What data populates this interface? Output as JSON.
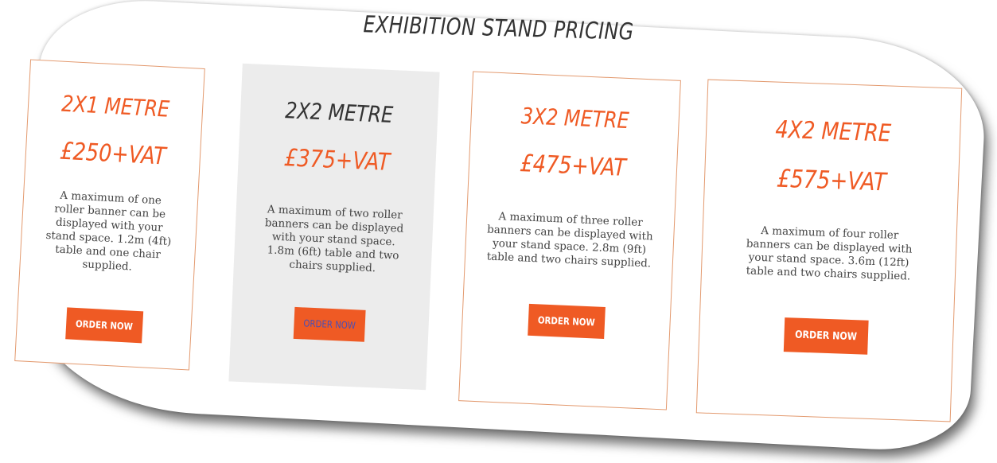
{
  "page": {
    "title": "EXHIBITION STAND PRICING"
  },
  "colors": {
    "accent": "#ef5a24",
    "highlight_bg": "#ececec",
    "card_border": "#e39a6f",
    "text": "#444444",
    "link_text": "#4b4fb5"
  },
  "cards": [
    {
      "size": "2X1 METRE",
      "price": "£250+VAT",
      "description": "A maximum of one roller banner can be displayed with your stand space. 1.2m (4ft) table and one chair supplied.",
      "button_label": "ORDER NOW"
    },
    {
      "size": "2X2 METRE",
      "price": "£375+VAT",
      "description": "A maximum of two roller banners can be displayed with your stand space. 1.8m (6ft) table and two chairs supplied.",
      "button_label": "ORDER NOW"
    },
    {
      "size": "3X2 METRE",
      "price": "£475+VAT",
      "description": "A maximum of three roller banners can be displayed with your stand space. 2.8m (9ft) table and two chairs supplied.",
      "button_label": "ORDER NOW"
    },
    {
      "size": "4X2 METRE",
      "price": "£575+VAT",
      "description": "A maximum of four roller banners can be displayed with your stand space. 3.6m (12ft) table and two chairs supplied.",
      "button_label": "ORDER NOW"
    }
  ]
}
